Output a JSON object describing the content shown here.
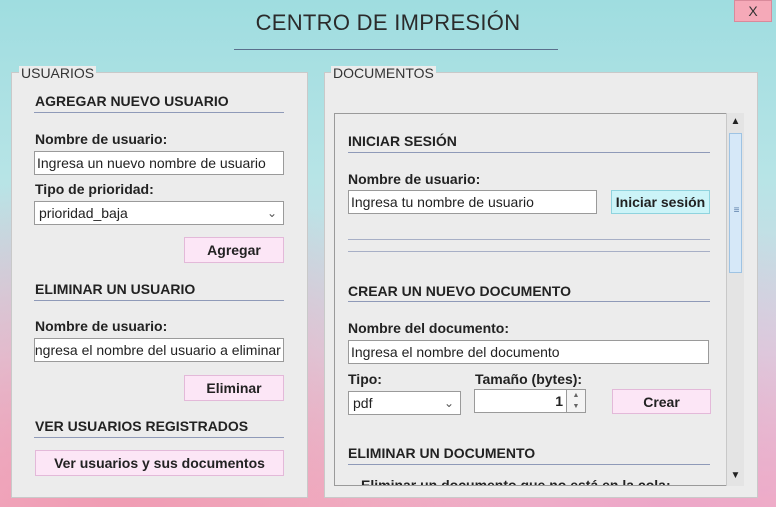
{
  "window": {
    "title": "CENTRO DE IMPRESIÓN",
    "close_label": "X"
  },
  "usuarios": {
    "panel_title": "USUARIOS",
    "agregar": {
      "title": "AGREGAR NUEVO USUARIO",
      "username_label": "Nombre de usuario:",
      "username_value": "Ingresa un nuevo nombre de usuario",
      "priority_label": "Tipo de prioridad:",
      "priority_value": "prioridad_baja",
      "button": "Agregar"
    },
    "eliminar": {
      "title": "ELIMINAR UN USUARIO",
      "username_label": "Nombre de usuario:",
      "username_value": "Ingresa el nombre del usuario a eliminar",
      "button": "Eliminar"
    },
    "ver": {
      "title": "VER USUARIOS REGISTRADOS",
      "button": "Ver usuarios y sus documentos"
    }
  },
  "documentos": {
    "panel_title": "DOCUMENTOS",
    "sesion": {
      "title": "INICIAR SESIÓN",
      "username_label": "Nombre de usuario:",
      "username_value": "Ingresa tu nombre de usuario",
      "button": "Iniciar sesión"
    },
    "crear": {
      "title": "CREAR UN NUEVO DOCUMENTO",
      "name_label": "Nombre del documento:",
      "name_value": "Ingresa el nombre del documento",
      "type_label": "Tipo:",
      "type_value": "pdf",
      "size_label": "Tamaño (bytes):",
      "size_value": "1",
      "button": "Crear"
    },
    "eliminar": {
      "title": "ELIMINAR UN DOCUMENTO",
      "subtitle": "Eliminar un documento que no está en la cola:"
    }
  }
}
